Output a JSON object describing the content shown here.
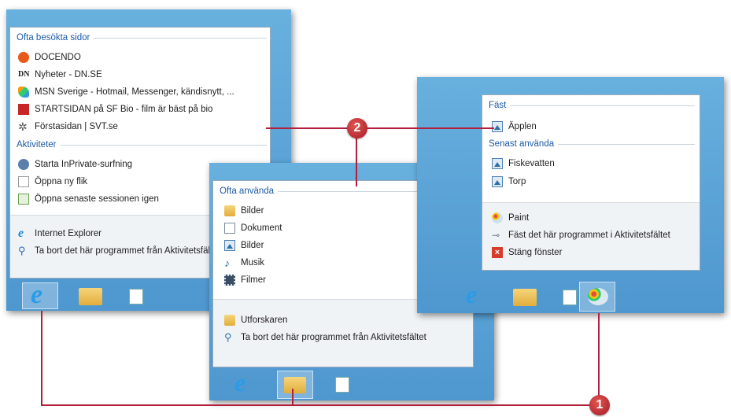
{
  "ie_jumplist": {
    "sections": [
      {
        "header": "Ofta besökta sidor",
        "items": [
          "DOCENDO",
          "Nyheter - DN.SE",
          "MSN Sverige - Hotmail, Messenger, kändisnytt, ...",
          "STARTSIDAN på SF Bio - film är bäst på bio",
          "Förstasidan | SVT.se"
        ]
      },
      {
        "header": "Aktiviteter",
        "items": [
          "Starta InPrivate-surfning",
          "Öppna ny flik",
          "Öppna senaste sessionen igen"
        ]
      }
    ],
    "footer": [
      "Internet Explorer",
      "Ta bort det här programmet från Aktivitetsfältet"
    ]
  },
  "explorer_jumplist": {
    "header": "Ofta använda",
    "items": [
      "Bilder",
      "Dokument",
      "Bilder",
      "Musik",
      "Filmer"
    ],
    "footer": [
      "Utforskaren",
      "Ta bort det här programmet från Aktivitetsfältet"
    ]
  },
  "paint_jumplist": {
    "pinned_header": "Fäst",
    "pinned_items": [
      "Äpplen"
    ],
    "recent_header": "Senast använda",
    "recent_items": [
      "Fiskevatten",
      "Torp"
    ],
    "footer": [
      "Paint",
      "Fäst det här programmet i Aktivitetsfältet",
      "Stäng fönster"
    ]
  },
  "callouts": {
    "one": "1",
    "two": "2"
  },
  "taskbar_icons": [
    "internet-explorer-icon",
    "file-explorer-icon",
    "wordpad-icon",
    "paint-icon"
  ],
  "colors": {
    "taskbar": "#5aa2d4",
    "callout": "#b01f3b",
    "section_header": "#1c5aa6"
  }
}
